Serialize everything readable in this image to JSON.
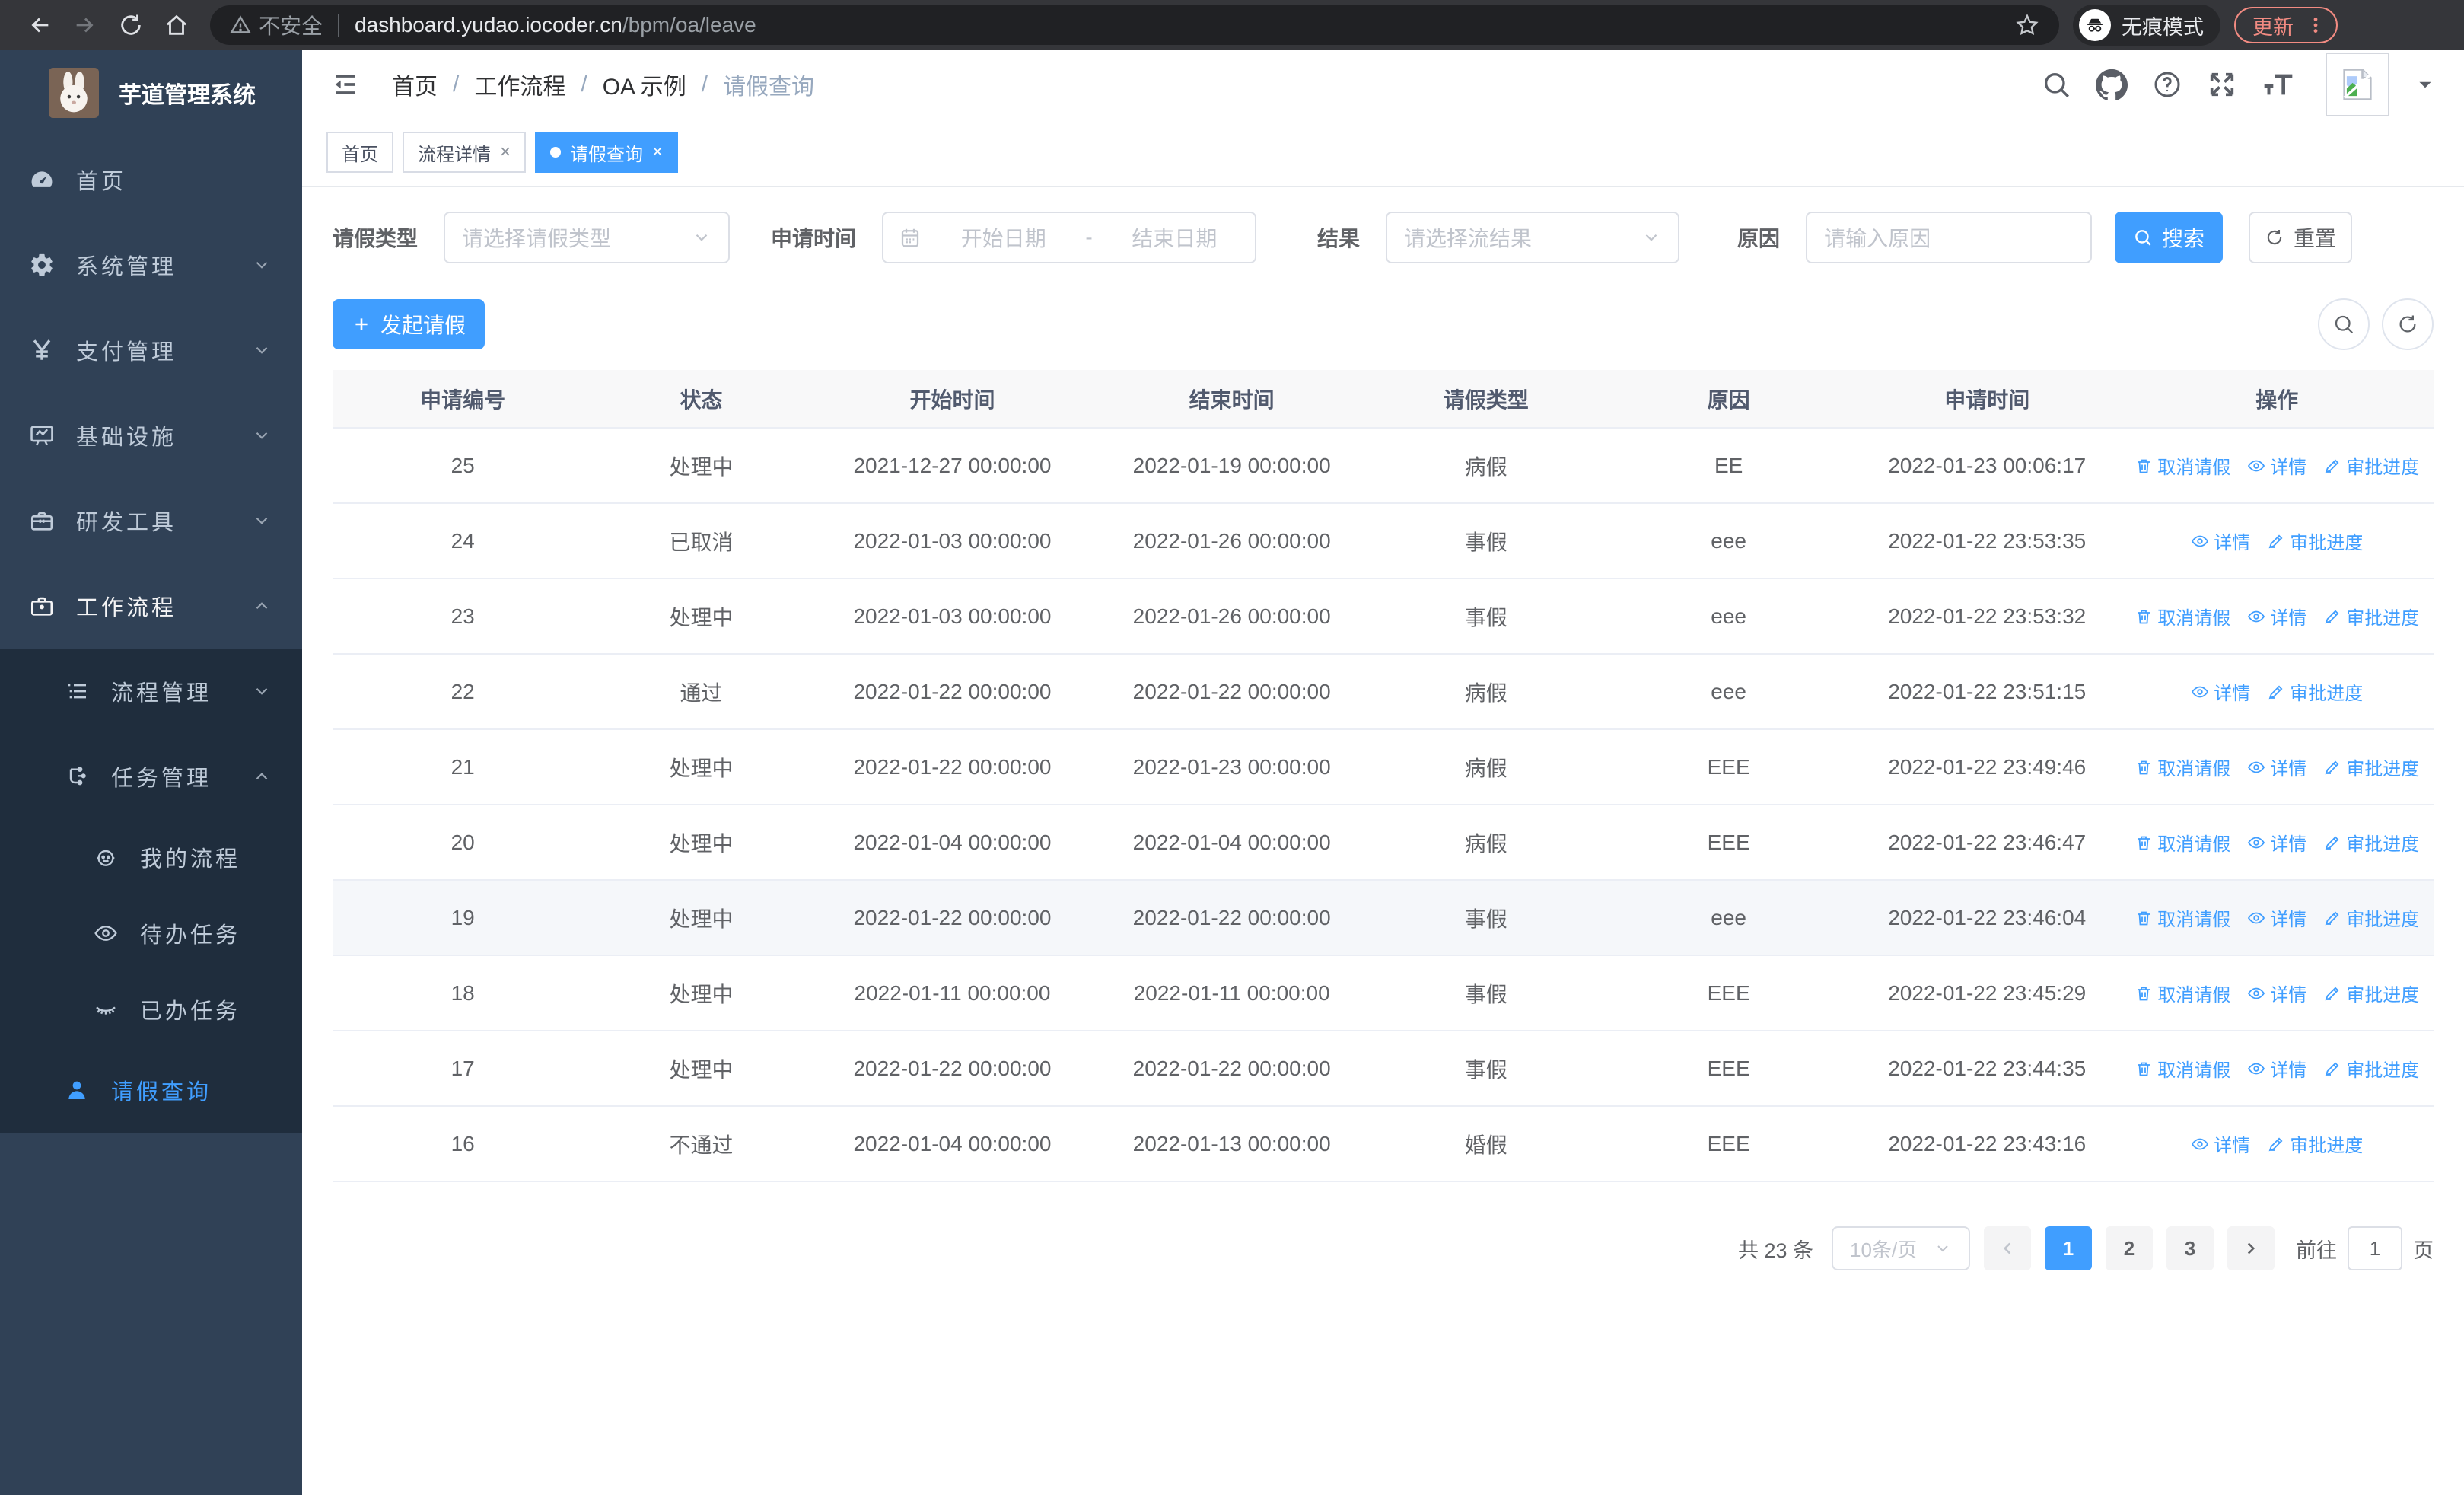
{
  "browser": {
    "security_label": "不安全",
    "url_host": "dashboard.yudao.iocoder.cn",
    "url_path": "/bpm/oa/leave",
    "incognito_label": "无痕模式",
    "update_label": "更新"
  },
  "sidebar": {
    "app_title": "芋道管理系统",
    "items": [
      {
        "label": "首页"
      },
      {
        "label": "系统管理"
      },
      {
        "label": "支付管理"
      },
      {
        "label": "基础设施"
      },
      {
        "label": "研发工具"
      },
      {
        "label": "工作流程"
      },
      {
        "label": "流程管理"
      },
      {
        "label": "任务管理"
      },
      {
        "label": "我的流程"
      },
      {
        "label": "待办任务"
      },
      {
        "label": "已办任务"
      },
      {
        "label": "请假查询"
      }
    ]
  },
  "breadcrumb": {
    "items": [
      "首页",
      "工作流程",
      "OA 示例",
      "请假查询"
    ]
  },
  "tabs": [
    {
      "label": "首页"
    },
    {
      "label": "流程详情"
    },
    {
      "label": "请假查询"
    }
  ],
  "filters": {
    "leave_type_label": "请假类型",
    "leave_type_placeholder": "请选择请假类型",
    "apply_time_label": "申请时间",
    "date_start_placeholder": "开始日期",
    "date_separator": "-",
    "date_end_placeholder": "结束日期",
    "result_label": "结果",
    "result_placeholder": "请选择流结果",
    "reason_label": "原因",
    "reason_placeholder": "请输入原因",
    "search_label": "搜索",
    "reset_label": "重置"
  },
  "toolbar": {
    "create_label": "发起请假"
  },
  "table": {
    "columns": [
      "申请编号",
      "状态",
      "开始时间",
      "结束时间",
      "请假类型",
      "原因",
      "申请时间",
      "操作"
    ],
    "action_labels": {
      "cancel": "取消请假",
      "detail": "详情",
      "progress": "审批进度"
    },
    "rows": [
      {
        "id": "25",
        "status": "处理中",
        "start_time": "2021-12-27 00:00:00",
        "end_time": "2022-01-19 00:00:00",
        "leave_type": "病假",
        "reason": "EE",
        "apply_time": "2022-01-23 00:06:17",
        "actions": [
          "cancel",
          "detail",
          "progress"
        ],
        "highlighted": false
      },
      {
        "id": "24",
        "status": "已取消",
        "start_time": "2022-01-03 00:00:00",
        "end_time": "2022-01-26 00:00:00",
        "leave_type": "事假",
        "reason": "eee",
        "apply_time": "2022-01-22 23:53:35",
        "actions": [
          "detail",
          "progress"
        ],
        "highlighted": false
      },
      {
        "id": "23",
        "status": "处理中",
        "start_time": "2022-01-03 00:00:00",
        "end_time": "2022-01-26 00:00:00",
        "leave_type": "事假",
        "reason": "eee",
        "apply_time": "2022-01-22 23:53:32",
        "actions": [
          "cancel",
          "detail",
          "progress"
        ],
        "highlighted": false
      },
      {
        "id": "22",
        "status": "通过",
        "start_time": "2022-01-22 00:00:00",
        "end_time": "2022-01-22 00:00:00",
        "leave_type": "病假",
        "reason": "eee",
        "apply_time": "2022-01-22 23:51:15",
        "actions": [
          "detail",
          "progress"
        ],
        "highlighted": false
      },
      {
        "id": "21",
        "status": "处理中",
        "start_time": "2022-01-22 00:00:00",
        "end_time": "2022-01-23 00:00:00",
        "leave_type": "病假",
        "reason": "EEE",
        "apply_time": "2022-01-22 23:49:46",
        "actions": [
          "cancel",
          "detail",
          "progress"
        ],
        "highlighted": false
      },
      {
        "id": "20",
        "status": "处理中",
        "start_time": "2022-01-04 00:00:00",
        "end_time": "2022-01-04 00:00:00",
        "leave_type": "病假",
        "reason": "EEE",
        "apply_time": "2022-01-22 23:46:47",
        "actions": [
          "cancel",
          "detail",
          "progress"
        ],
        "highlighted": false
      },
      {
        "id": "19",
        "status": "处理中",
        "start_time": "2022-01-22 00:00:00",
        "end_time": "2022-01-22 00:00:00",
        "leave_type": "事假",
        "reason": "eee",
        "apply_time": "2022-01-22 23:46:04",
        "actions": [
          "cancel",
          "detail",
          "progress"
        ],
        "highlighted": true
      },
      {
        "id": "18",
        "status": "处理中",
        "start_time": "2022-01-11 00:00:00",
        "end_time": "2022-01-11 00:00:00",
        "leave_type": "事假",
        "reason": "EEE",
        "apply_time": "2022-01-22 23:45:29",
        "actions": [
          "cancel",
          "detail",
          "progress"
        ],
        "highlighted": false
      },
      {
        "id": "17",
        "status": "处理中",
        "start_time": "2022-01-22 00:00:00",
        "end_time": "2022-01-22 00:00:00",
        "leave_type": "事假",
        "reason": "EEE",
        "apply_time": "2022-01-22 23:44:35",
        "actions": [
          "cancel",
          "detail",
          "progress"
        ],
        "highlighted": false
      },
      {
        "id": "16",
        "status": "不通过",
        "start_time": "2022-01-04 00:00:00",
        "end_time": "2022-01-13 00:00:00",
        "leave_type": "婚假",
        "reason": "EEE",
        "apply_time": "2022-01-22 23:43:16",
        "actions": [
          "detail",
          "progress"
        ],
        "highlighted": false
      }
    ]
  },
  "pagination": {
    "total_label": "共 23 条",
    "page_size": "10条/页",
    "pages": [
      "1",
      "2",
      "3"
    ],
    "goto_label": "前往",
    "goto_value": "1",
    "page_suffix": "页"
  },
  "colors": {
    "primary": "#409eff",
    "sidebar_bg": "#304156",
    "submenu_bg": "#1f2d3d"
  }
}
